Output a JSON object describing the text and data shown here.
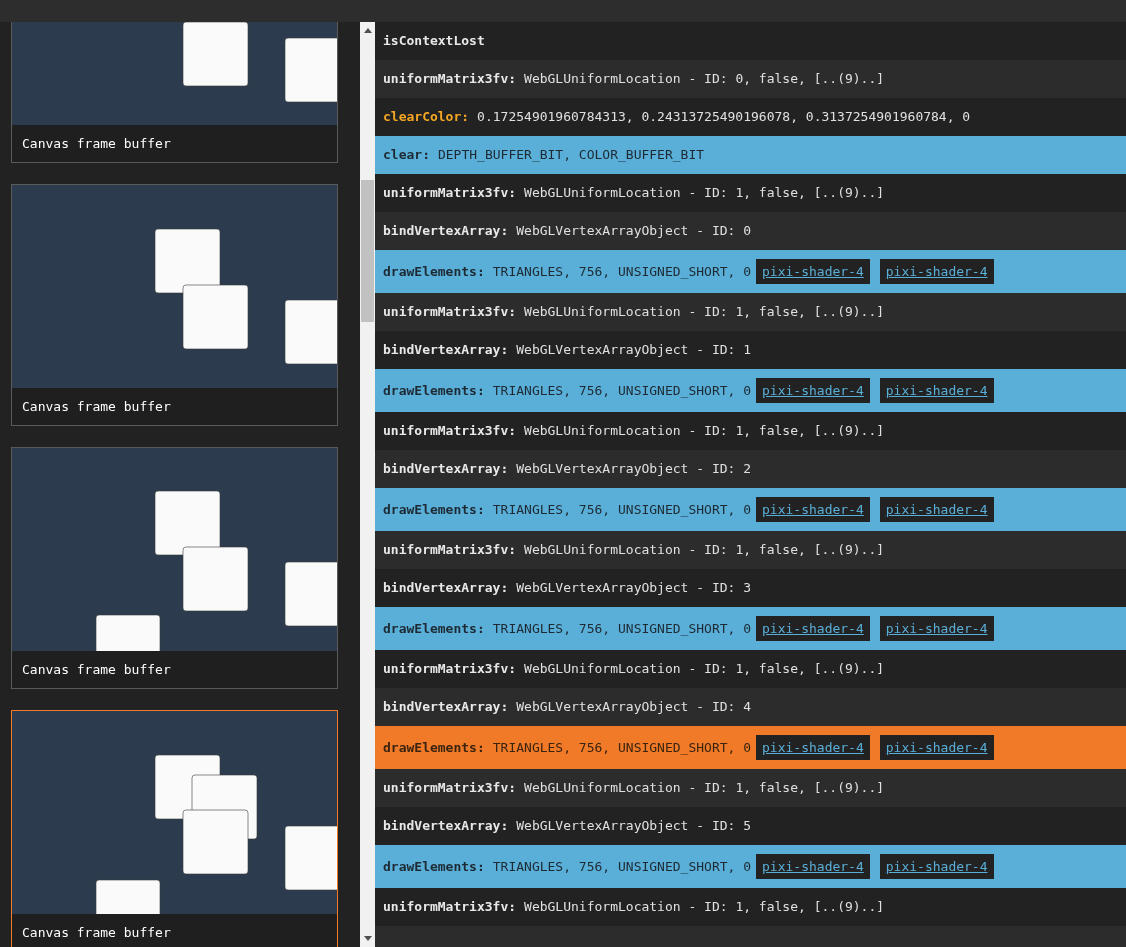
{
  "frames": [
    {
      "caption": "Canvas frame buffer",
      "selected": false
    },
    {
      "caption": "Canvas frame buffer",
      "selected": false
    },
    {
      "caption": "Canvas frame buffer",
      "selected": false
    },
    {
      "caption": "Canvas frame buffer",
      "selected": true
    }
  ],
  "calls": [
    {
      "name": "isContextLost",
      "highlighted": false,
      "selected": false,
      "modified": false
    },
    {
      "name": "uniformMatrix3fv:",
      "args": "WebGLUniformLocation - ID: 0, false, [..(9)..]",
      "highlighted": false,
      "selected": false,
      "modified": false
    },
    {
      "name": "clearColor:",
      "args": "0.17254901960784313, 0.24313725490196078, 0.3137254901960784, 0",
      "highlighted": false,
      "selected": false,
      "modified": true
    },
    {
      "name": "clear:",
      "args": "DEPTH_BUFFER_BIT, COLOR_BUFFER_BIT",
      "highlighted": true,
      "selected": false,
      "modified": false
    },
    {
      "name": "uniformMatrix3fv:",
      "args": "WebGLUniformLocation - ID: 1, false, [..(9)..]",
      "highlighted": false,
      "selected": false,
      "modified": false
    },
    {
      "name": "bindVertexArray:",
      "args": "WebGLVertexArrayObject - ID: 0",
      "highlighted": false,
      "selected": false,
      "modified": false
    },
    {
      "name": "drawElements:",
      "args": "TRIANGLES, 756, UNSIGNED_SHORT, 0",
      "highlighted": true,
      "selected": false,
      "modified": false,
      "links": [
        "pixi-shader-4",
        "pixi-shader-4"
      ]
    },
    {
      "name": "uniformMatrix3fv:",
      "args": "WebGLUniformLocation - ID: 1, false, [..(9)..]",
      "highlighted": false,
      "selected": false,
      "modified": false
    },
    {
      "name": "bindVertexArray:",
      "args": "WebGLVertexArrayObject - ID: 1",
      "highlighted": false,
      "selected": false,
      "modified": false
    },
    {
      "name": "drawElements:",
      "args": "TRIANGLES, 756, UNSIGNED_SHORT, 0",
      "highlighted": true,
      "selected": false,
      "modified": false,
      "links": [
        "pixi-shader-4",
        "pixi-shader-4"
      ]
    },
    {
      "name": "uniformMatrix3fv:",
      "args": "WebGLUniformLocation - ID: 1, false, [..(9)..]",
      "highlighted": false,
      "selected": false,
      "modified": false
    },
    {
      "name": "bindVertexArray:",
      "args": "WebGLVertexArrayObject - ID: 2",
      "highlighted": false,
      "selected": false,
      "modified": false
    },
    {
      "name": "drawElements:",
      "args": "TRIANGLES, 756, UNSIGNED_SHORT, 0",
      "highlighted": true,
      "selected": false,
      "modified": false,
      "links": [
        "pixi-shader-4",
        "pixi-shader-4"
      ]
    },
    {
      "name": "uniformMatrix3fv:",
      "args": "WebGLUniformLocation - ID: 1, false, [..(9)..]",
      "highlighted": false,
      "selected": false,
      "modified": false
    },
    {
      "name": "bindVertexArray:",
      "args": "WebGLVertexArrayObject - ID: 3",
      "highlighted": false,
      "selected": false,
      "modified": false
    },
    {
      "name": "drawElements:",
      "args": "TRIANGLES, 756, UNSIGNED_SHORT, 0",
      "highlighted": true,
      "selected": false,
      "modified": false,
      "links": [
        "pixi-shader-4",
        "pixi-shader-4"
      ]
    },
    {
      "name": "uniformMatrix3fv:",
      "args": "WebGLUniformLocation - ID: 1, false, [..(9)..]",
      "highlighted": false,
      "selected": false,
      "modified": false
    },
    {
      "name": "bindVertexArray:",
      "args": "WebGLVertexArrayObject - ID: 4",
      "highlighted": false,
      "selected": false,
      "modified": false
    },
    {
      "name": "drawElements:",
      "args": "TRIANGLES, 756, UNSIGNED_SHORT, 0",
      "highlighted": false,
      "selected": true,
      "modified": false,
      "links": [
        "pixi-shader-4",
        "pixi-shader-4"
      ]
    },
    {
      "name": "uniformMatrix3fv:",
      "args": "WebGLUniformLocation - ID: 1, false, [..(9)..]",
      "highlighted": false,
      "selected": false,
      "modified": false
    },
    {
      "name": "bindVertexArray:",
      "args": "WebGLVertexArrayObject - ID: 5",
      "highlighted": false,
      "selected": false,
      "modified": false
    },
    {
      "name": "drawElements:",
      "args": "TRIANGLES, 756, UNSIGNED_SHORT, 0",
      "highlighted": true,
      "selected": false,
      "modified": false,
      "links": [
        "pixi-shader-4",
        "pixi-shader-4"
      ]
    },
    {
      "name": "uniformMatrix3fv:",
      "args": "WebGLUniformLocation - ID: 1, false, [..(9)..]",
      "highlighted": false,
      "selected": false,
      "modified": false
    }
  ]
}
